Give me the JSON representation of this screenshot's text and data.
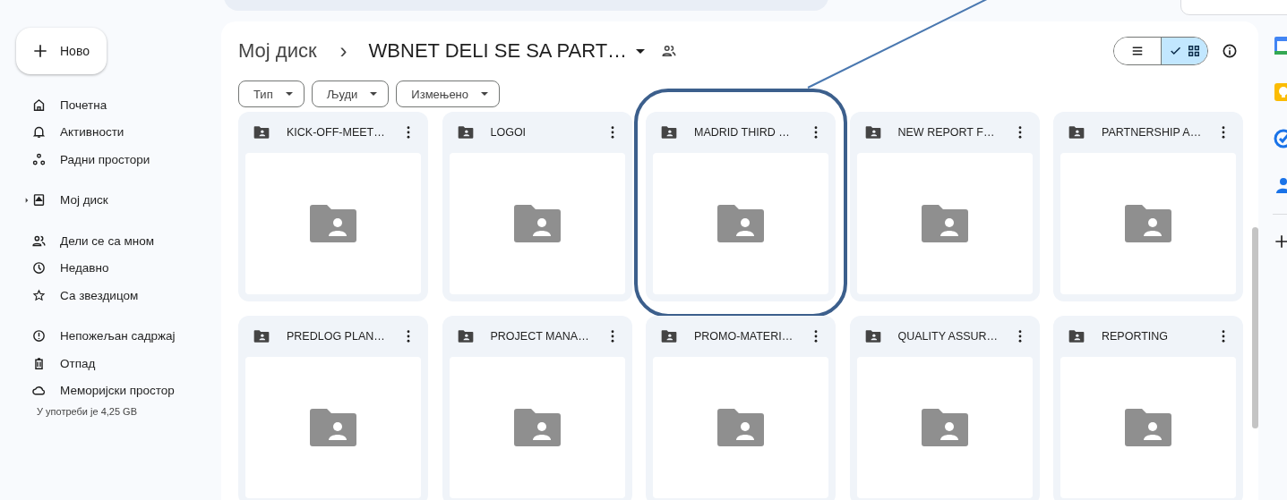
{
  "new_button": {
    "label": "Ново"
  },
  "sidebar": {
    "items": [
      {
        "label": "Почетна",
        "expandable": false
      },
      {
        "label": "Активности",
        "expandable": false
      },
      {
        "label": "Радни простори",
        "expandable": false
      },
      {
        "label": "Мој диск",
        "expandable": true
      },
      {
        "label": "Дели се са мном",
        "expandable": false
      },
      {
        "label": "Недавно",
        "expandable": false
      },
      {
        "label": "Са звездицом",
        "expandable": false
      },
      {
        "label": "Непожељан садржај",
        "expandable": false
      },
      {
        "label": "Отпад",
        "expandable": false
      },
      {
        "label": "Меморијски простор",
        "expandable": false
      }
    ],
    "storage_text": "У употреби је 4,25 GB"
  },
  "breadcrumb": {
    "root": "Мој диск",
    "separator": "›",
    "current": "WBNET DELI SE SA PART…"
  },
  "filters": [
    {
      "label": "Тип"
    },
    {
      "label": "Људи"
    },
    {
      "label": "Измењено"
    }
  ],
  "view_toggle": [
    {
      "kind": "list",
      "selected": false
    },
    {
      "kind": "grid",
      "selected": true
    }
  ],
  "folders": [
    {
      "name": "KICK-OFF-MEET…",
      "highlighted": false
    },
    {
      "name": "LOGOI",
      "highlighted": false
    },
    {
      "name": "MADRID THIRD …",
      "highlighted": true
    },
    {
      "name": "NEW REPORT F…",
      "highlighted": false
    },
    {
      "name": "PARTNERSHIP A…",
      "highlighted": false
    },
    {
      "name": "PREDLOG PLAN…",
      "highlighted": false
    },
    {
      "name": "PROJECT MANA…",
      "highlighted": false
    },
    {
      "name": "PROMO-MATERI…",
      "highlighted": false
    },
    {
      "name": "QUALITY ASSUR…",
      "highlighted": false
    },
    {
      "name": "REPORTING",
      "highlighted": false
    }
  ]
}
